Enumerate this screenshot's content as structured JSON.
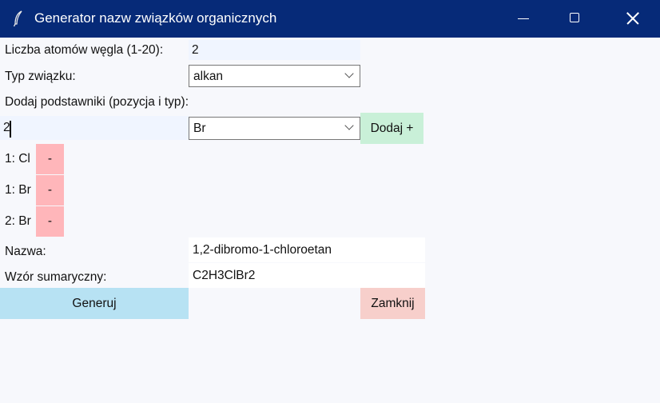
{
  "window": {
    "title": "Generator nazw związków organicznych"
  },
  "form": {
    "carbon_label": "Liczba atomów węgla (1-20):",
    "carbon_value": "2",
    "type_label": "Typ związku:",
    "type_value": "alkan",
    "substituents_label": "Dodaj podstawniki (pozycja i typ):",
    "position_value": "2",
    "substituent_type_value": "Br",
    "add_button": "Dodaj +"
  },
  "substituents": [
    {
      "label": "1: Cl",
      "remove": "-"
    },
    {
      "label": "1: Br",
      "remove": "-"
    },
    {
      "label": "2: Br",
      "remove": "-"
    }
  ],
  "result": {
    "name_label": "Nazwa:",
    "name_value": "1,2-dibromo-1-chloroetan",
    "formula_label": "Wzór sumaryczny:",
    "formula_value": "C2H3ClBr2"
  },
  "actions": {
    "generate": "Generuj",
    "close": "Zamknij"
  }
}
